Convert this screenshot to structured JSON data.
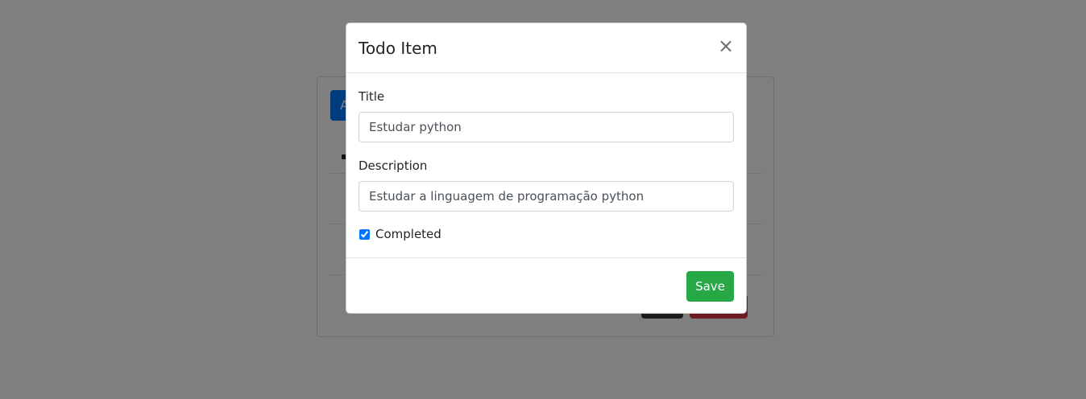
{
  "background": {
    "add_button_label": "A"
  },
  "modal": {
    "title": "Todo Item",
    "close_symbol": "×",
    "fields": {
      "title_label": "Title",
      "title_value": "Estudar python",
      "description_label": "Description",
      "description_value": "Estudar a linguagem de programação python",
      "completed_label": "Completed",
      "completed_checked": true
    },
    "save_label": "Save"
  },
  "colors": {
    "backdrop": "rgba(0,0,0,0.5)",
    "primary": "#007bff",
    "success": "#28a745",
    "danger": "#dc3545",
    "dark": "#343a40"
  },
  "icons": {
    "close": "close-icon"
  }
}
